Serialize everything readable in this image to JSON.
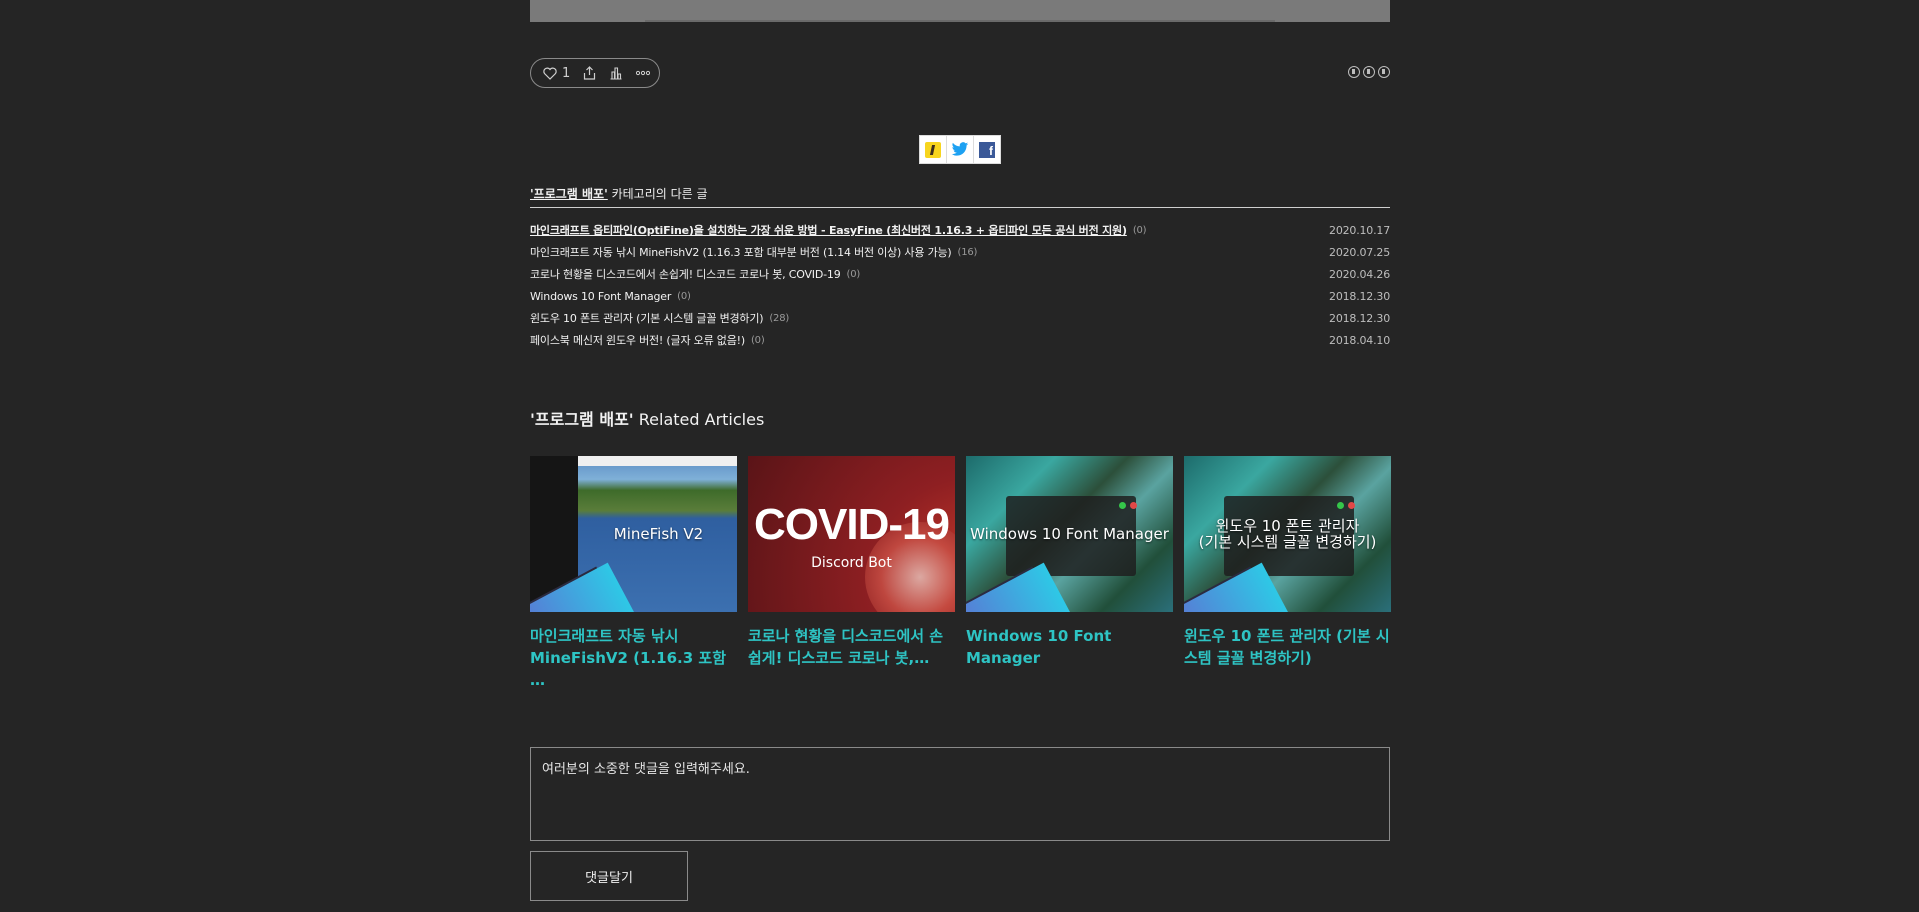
{
  "reactions": {
    "like_count": "1"
  },
  "sns": [
    {
      "icon": "kakaostory-icon"
    },
    {
      "icon": "twitter-icon"
    },
    {
      "icon": "facebook-icon"
    }
  ],
  "category": {
    "name": "'프로그램 배포'",
    "suffix": " 카테고리의 다른 글",
    "posts": [
      {
        "title": "마인크래프트 옵티파인(OptiFine)을 설치하는 가장 쉬운 방법 - EasyFine (최신버전 1.16.3 + 옵티파인 모든 공식 버전 지원)",
        "count": "(0)",
        "date": "2020.10.17"
      },
      {
        "title": "마인크래프트 자동 낚시 MineFishV2 (1.16.3 포함 대부분 버전 (1.14 버전 이상) 사용 가능)",
        "count": "(16)",
        "date": "2020.07.25"
      },
      {
        "title": "코로나 현황을 디스코드에서 손쉽게! 디스코드 코로나 봇, COVID-19",
        "count": "(0)",
        "date": "2020.04.26"
      },
      {
        "title": "Windows 10 Font Manager",
        "count": "(0)",
        "date": "2018.12.30"
      },
      {
        "title": "윈도우 10 폰트 관리자 (기본 시스템 글꼴 변경하기)",
        "count": "(28)",
        "date": "2018.12.30"
      },
      {
        "title": "페이스북 메신저 윈도우 버전! (글자 오류 없음!)",
        "count": "(0)",
        "date": "2018.04.10"
      }
    ]
  },
  "related": {
    "heading_cat": "'프로그램 배포'",
    "heading_suffix": " Related Articles",
    "cards": [
      {
        "thumb_text": "MineFish V2",
        "title": "마인크래프트 자동 낚시 MineFishV2 (1.16.3 포함 …"
      },
      {
        "thumb_big": "COVID-19",
        "thumb_small": "Discord Bot",
        "title": "코로나 현황을 디스코드에서 손쉽게! 디스코드 코로나 봇,…"
      },
      {
        "thumb_text": "Windows 10 Font Manager",
        "title": "Windows 10 Font Manager"
      },
      {
        "thumb_text_1": "윈도우 10 폰트 관리자",
        "thumb_text_2": "(기본 시스템 글꼴 변경하기)",
        "title": "윈도우 10 폰트 관리자 (기본 시스템 글꼴 변경하기)"
      }
    ]
  },
  "comment": {
    "placeholder": "여러분의 소중한 댓글을 입력해주세요.",
    "submit_label": "댓글달기"
  },
  "colors": {
    "background": "#252525",
    "link_accent": "#2ec4c4"
  }
}
